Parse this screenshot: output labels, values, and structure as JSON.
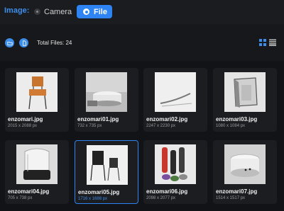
{
  "header": {
    "image_label": "Image:",
    "camera_label": "Camera",
    "file_label": "File",
    "selected_source": "File"
  },
  "toolbar": {
    "total_files": "Total Files: 24",
    "folder_icon": "folder-icon",
    "document_icon": "document-icon",
    "grid_view_icon": "grid-view-icon",
    "list_view_icon": "list-view-icon",
    "active_view": "grid"
  },
  "colors": {
    "accent": "#2d84f2",
    "background": "#121316",
    "card": "#1c1d21"
  },
  "files": [
    {
      "name": "enzomari.jpg",
      "dims": "2015 x 2088 px"
    },
    {
      "name": "enzomari01.jpg",
      "dims": "732 x 735 px"
    },
    {
      "name": "enzomari02.jpg",
      "dims": "2247 x 2230 px"
    },
    {
      "name": "enzomari03.jpg",
      "dims": "1080 x 1084 px"
    },
    {
      "name": "enzomari04.jpg",
      "dims": "705 x 738 px"
    },
    {
      "name": "enzomari05.jpg",
      "dims": "1716 x 1688 px",
      "selected": true
    },
    {
      "name": "enzomari06.jpg",
      "dims": "2098 x 2077 px"
    },
    {
      "name": "enzomari07.jpg",
      "dims": "1514 x 1517 px"
    }
  ]
}
